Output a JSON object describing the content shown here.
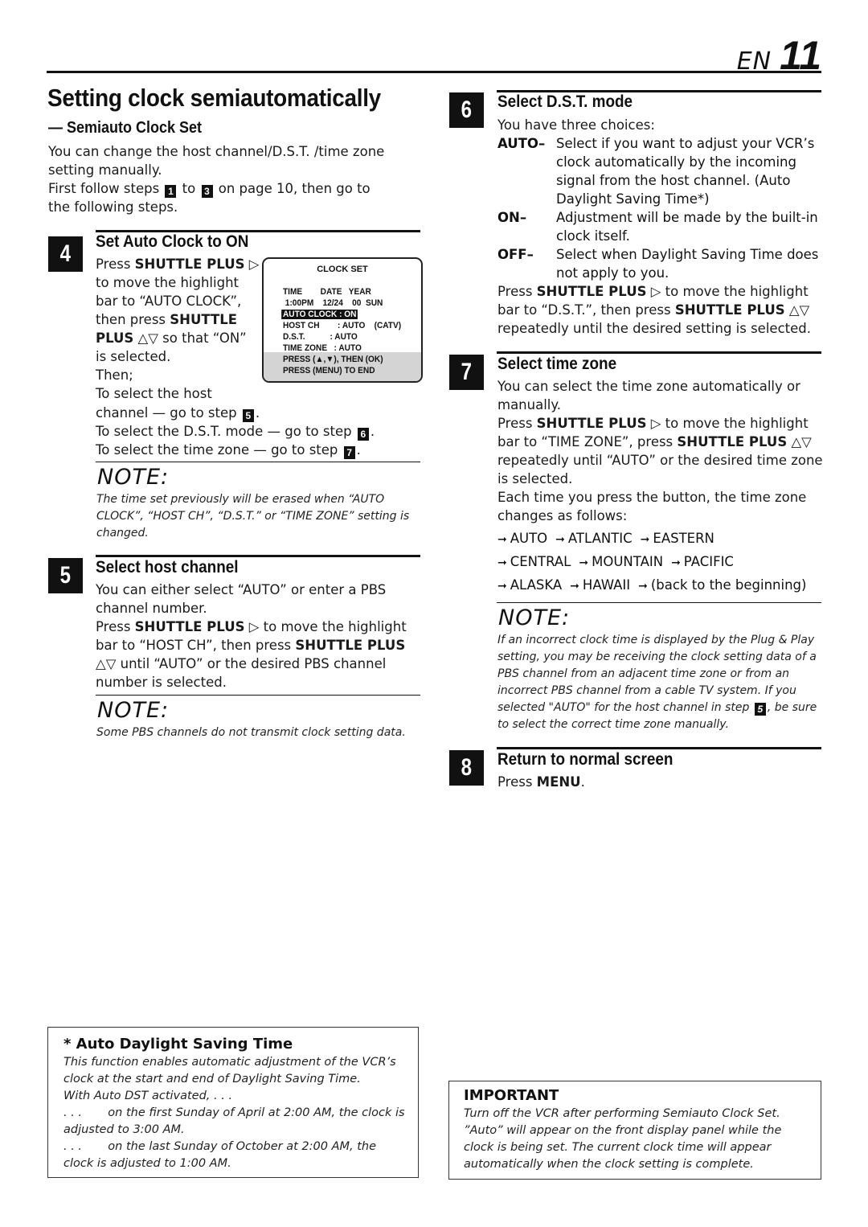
{
  "header": {
    "lang": "EN",
    "page_number": "11"
  },
  "section": {
    "title": "Setting clock semiautomatically",
    "subtitle": "— Semiauto Clock Set",
    "intro_1": "You can change the host channel/D.S.T. /time zone setting manually.",
    "intro_2_pre": "First follow steps",
    "intro_2_step_a": "1",
    "intro_2_mid": "to",
    "intro_2_step_b": "3",
    "intro_2_post": "on page 10, then go to the following steps."
  },
  "steps": [
    {
      "num": "4",
      "title": "Set Auto Clock to ON",
      "lines": [
        {
          "pre": "Press ",
          "bold": "SHUTTLE PLUS",
          "post": " ▷"
        },
        {
          "pre": "to move the highlight",
          "bold": "",
          "post": ""
        },
        {
          "pre": "bar to “AUTO CLOCK”,",
          "bold": "",
          "post": ""
        },
        {
          "pre": "then press ",
          "bold": "SHUTTLE",
          "post": ""
        },
        {
          "pre": "",
          "bold": "PLUS",
          "post": " △▽ so that “ON”"
        },
        {
          "pre": "is selected.",
          "bold": "",
          "post": ""
        },
        {
          "pre": "Then;",
          "bold": "",
          "post": ""
        },
        {
          "pre": "To select the host",
          "bold": "",
          "post": ""
        }
      ],
      "goto": [
        {
          "text": "channel — go to step",
          "step": "5"
        },
        {
          "text": "To select the D.S.T. mode — go to step",
          "step": "6"
        },
        {
          "text": "To select the time zone — go to step",
          "step": "7"
        }
      ],
      "note_head": "NOTE:",
      "note": "The time set previously will be erased when “AUTO CLOCK”, “HOST CH”, “D.S.T.” or “TIME ZONE” setting is changed."
    },
    {
      "num": "5",
      "title": "Select host channel",
      "text_1": "You can either select “AUTO” or enter a PBS channel number.",
      "text_2_pre": "Press ",
      "text_2_bold_a": "SHUTTLE PLUS",
      "text_2_mid": " ▷ to move the highlight bar to “HOST CH”, then press ",
      "text_2_bold_b": "SHUTTLE PLUS",
      "text_2_post": " △▽ until “AUTO” or the desired PBS channel number is selected.",
      "note_head": "NOTE:",
      "note": "Some PBS channels do not transmit clock setting data."
    },
    {
      "num": "6",
      "title": "Select D.S.T. mode",
      "intro": "You have three choices:",
      "choices": [
        {
          "term": "AUTO–",
          "desc": "Select if you want to adjust your VCR’s clock automatically by the incoming signal from the host channel. (Auto Daylight Saving Time*)"
        },
        {
          "term": "ON–",
          "desc": "Adjustment will be made by the built-in clock itself."
        },
        {
          "term": "OFF–",
          "desc": "Select when Daylight Saving Time does not apply to you."
        }
      ],
      "text_pre": "Press ",
      "text_bold_a": "SHUTTLE PLUS",
      "text_mid": " ▷ to move the highlight bar to “D.S.T.”, then press ",
      "text_bold_b": "SHUTTLE PLUS",
      "text_post": " △▽ repeatedly until the desired setting is selected."
    },
    {
      "num": "7",
      "title": "Select time zone",
      "text_1": "You can select the time zone automatically or manually.",
      "text_2_pre": "Press ",
      "text_2_bold_a": "SHUTTLE PLUS",
      "text_2_mid": " ▷ to move the highlight bar to “TIME ZONE”, press ",
      "text_2_bold_b": "SHUTTLE PLUS",
      "text_2_post": " △▽ repeatedly until “AUTO” or the desired time zone is selected.",
      "text_3": "Each time you press the button, the time zone changes as follows:",
      "sequence": [
        [
          "AUTO",
          "ATLANTIC",
          "EASTERN"
        ],
        [
          "CENTRAL",
          "MOUNTAIN",
          "PACIFIC"
        ],
        [
          "ALASKA",
          "HAWAII",
          "(back to the beginning)"
        ]
      ],
      "note_head": "NOTE:",
      "note_pre": "If an incorrect clock time is displayed by the Plug & Play setting, you may be receiving the clock setting data of a PBS channel from an adjacent time zone or from an incorrect PBS channel from a cable TV system. If you selected \"AUTO\" for the host channel in step",
      "note_step": "5",
      "note_post": ", be sure to select the correct time zone manually."
    },
    {
      "num": "8",
      "title": "Return to normal screen",
      "text_pre": "Press ",
      "text_bold": "MENU",
      "text_post": "."
    }
  ],
  "osd": {
    "title": "CLOCK SET",
    "header_row": "TIME        DATE   YEAR",
    "value_row": " 1:00PM    12/24    00  SUN",
    "highlight_row": "AUTO CLOCK : ON",
    "host_row": "HOST CH        : AUTO    (CATV)",
    "dst_row": "D.S.T.           : AUTO",
    "tz_row": "TIME ZONE   : AUTO",
    "footer_1": "PRESS (▲,▼), THEN (OK)",
    "footer_2": "PRESS (MENU) TO END"
  },
  "dst_box": {
    "title": "* Auto Daylight Saving Time",
    "lines": [
      "This function enables automatic adjustment of the VCR’s clock at the start and end of Daylight Saving Time.",
      "With Auto DST activated, . . .",
      ". . .       on the first Sunday of April at 2:00 AM, the clock is adjusted to 3:00 AM.",
      ". . .       on the last Sunday of October at 2:00 AM, the clock is adjusted to 1:00 AM."
    ]
  },
  "important_box": {
    "title": "IMPORTANT",
    "text": "Turn off the VCR after performing Semiauto Clock Set. ”Auto” will appear on the front display panel while the clock is being set. The current clock time will appear automatically when the clock setting is complete."
  }
}
